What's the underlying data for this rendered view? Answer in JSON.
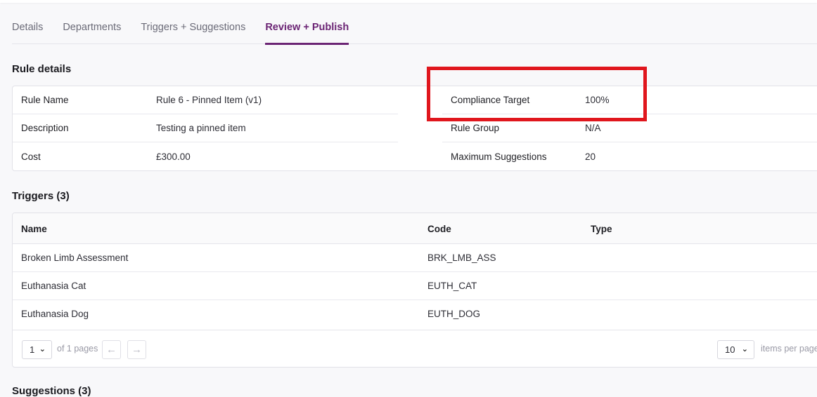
{
  "tabs": [
    {
      "label": "Details",
      "active": false
    },
    {
      "label": "Departments",
      "active": false
    },
    {
      "label": "Triggers + Suggestions",
      "active": false
    },
    {
      "label": "Review + Publish",
      "active": true
    }
  ],
  "rule_details": {
    "title": "Rule details",
    "left": [
      {
        "key": "Rule Name",
        "value": "Rule 6 - Pinned Item (v1)"
      },
      {
        "key": "Description",
        "value": "Testing a pinned item"
      },
      {
        "key": "Cost",
        "value": "£300.00"
      }
    ],
    "right": [
      {
        "key": "Compliance Target",
        "value": "100%"
      },
      {
        "key": "Rule Group",
        "value": "N/A"
      },
      {
        "key": "Maximum Suggestions",
        "value": "20"
      }
    ]
  },
  "triggers": {
    "title": "Triggers (3)",
    "columns": [
      "Name",
      "Code",
      "Type"
    ],
    "rows": [
      {
        "name": "Broken Limb Assessment",
        "code": "BRK_LMB_ASS",
        "type": ""
      },
      {
        "name": "Euthanasia Cat",
        "code": "EUTH_CAT",
        "type": ""
      },
      {
        "name": "Euthanasia Dog",
        "code": "EUTH_DOG",
        "type": ""
      }
    ],
    "pager": {
      "page_value": "1",
      "of_pages": "of 1 pages",
      "per_page_value": "10",
      "per_page_label": "items per page"
    }
  },
  "suggestions": {
    "title": "Suggestions (3)"
  },
  "icons": {
    "prev": "arrow-left-icon",
    "next": "arrow-right-icon",
    "chevron": "chevron-down-icon"
  },
  "colors": {
    "accent": "#6b2474",
    "highlight": "#e0161d"
  }
}
